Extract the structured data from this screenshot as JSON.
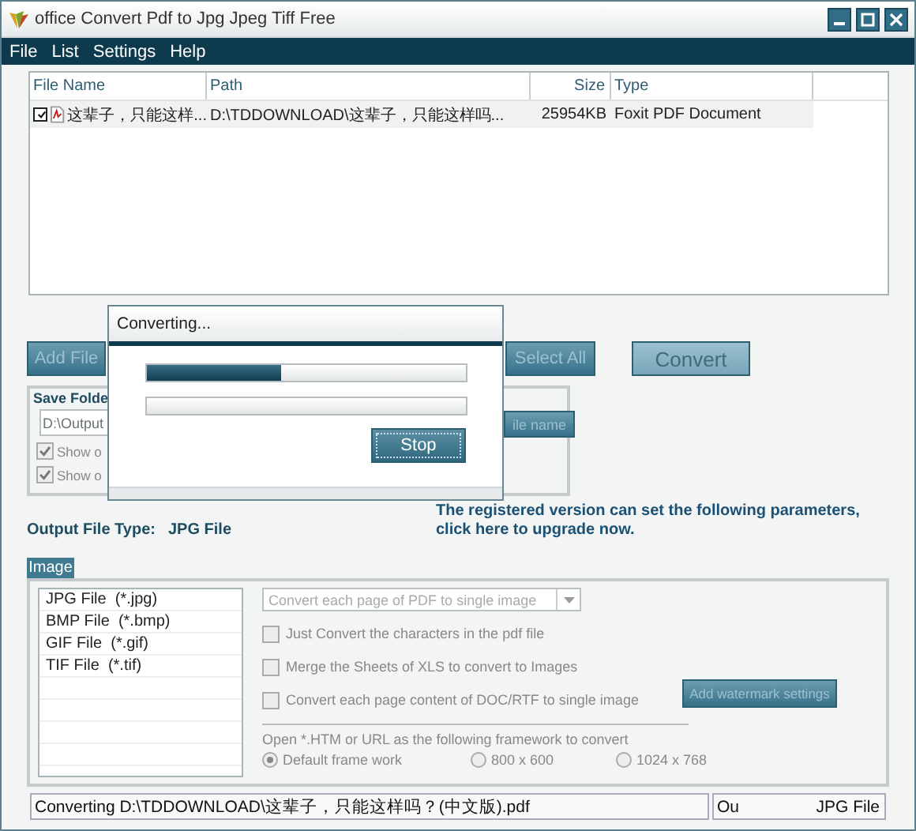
{
  "window": {
    "title": "office Convert Pdf to Jpg Jpeg Tiff Free"
  },
  "menu": [
    "File",
    "List",
    "Settings",
    "Help"
  ],
  "file_table": {
    "columns": [
      "File Name",
      "Path",
      "Size",
      "Type"
    ],
    "rows": [
      {
        "checked": true,
        "name": "这辈子，只能这样...",
        "path": "D:\\TDDOWNLOAD\\这辈子，只能这样吗...",
        "size": "25954KB",
        "type": "Foxit PDF Document"
      }
    ]
  },
  "buttons": [
    "Add File",
    "Select All",
    "Convert"
  ],
  "save_folder": {
    "title": "Save Folde",
    "path": "D:\\Output",
    "options": [
      {
        "label": "Show o",
        "checked": true
      },
      {
        "label": "Show o",
        "checked": true
      }
    ],
    "button": "ile name"
  },
  "output_type": {
    "label": "Output File Type:",
    "value": "JPG File"
  },
  "upgrade_note": "The registered version can set the following parameters, click here to upgrade now.",
  "tabs": [
    {
      "label": "Image",
      "selected": true
    }
  ],
  "formats": [
    "JPG File  (*.jpg)",
    "BMP File  (*.bmp)",
    "GIF File  (*.gif)",
    "TIF File  (*.tif)"
  ],
  "image_options": {
    "mode_dropdown": "Convert each page of PDF to single image",
    "checkboxes": [
      {
        "label": "Just Convert the characters in the pdf file",
        "checked": false
      },
      {
        "label": "Merge the Sheets of XLS to convert to Images",
        "checked": false
      },
      {
        "label": "Convert each page content of DOC/RTF to single image",
        "checked": false
      }
    ],
    "watermark_button": "Add watermark settings",
    "frame_label": "Open *.HTM or URL as the following framework to convert",
    "frames": [
      {
        "label": "Default frame work",
        "selected": true
      },
      {
        "label": "800 x 600",
        "selected": false
      },
      {
        "label": "1024 x 768",
        "selected": false
      }
    ]
  },
  "status_bar": {
    "message": "Converting D:\\TDDOWNLOAD\\这辈子，只能这样吗？(中文版).pdf",
    "right_start": "Ou",
    "right_end": "JPG File"
  },
  "dialog": {
    "title": "Converting...",
    "progress": {
      "level": 0.42
    },
    "button": "Stop"
  }
}
